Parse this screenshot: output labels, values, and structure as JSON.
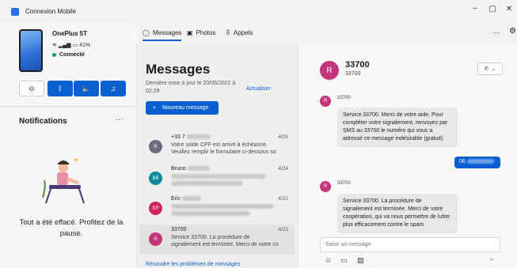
{
  "app": {
    "title": "Connexion Mobile",
    "window_controls": [
      "−",
      "▢",
      "✕"
    ]
  },
  "device": {
    "name": "OnePlus 5T",
    "battery": "41%",
    "status": "Connecté"
  },
  "quick_actions": [
    "⊖",
    "bluetooth",
    "volume",
    "music"
  ],
  "notifications": {
    "title": "Notifications",
    "more": "···",
    "empty_message": "Tout a été effacé. Profitez de la pause."
  },
  "tabs": [
    {
      "label": "Messages",
      "active": true
    },
    {
      "label": "Photos"
    },
    {
      "label": "Appels"
    }
  ],
  "top_more": "···",
  "messages": {
    "title": "Messages",
    "updated": "Dernière mise à jour le 20/05/2022 à 02:29",
    "refresh": "Actualiser",
    "new_button": "Nouveau message",
    "plus": "+",
    "troubleshoot": "Résoudre les problèmes de messages"
  },
  "conversations": [
    {
      "initials": "R",
      "name": "+33 7",
      "date": "4/26",
      "preview": "Votre solde CPF est arrivé à échéance. Veuillez remplir le formulaire ci-dessous so",
      "color": "#6b6b7b"
    },
    {
      "initials": "BB",
      "name": "Bruno",
      "date": "4/24",
      "preview": "",
      "color": "#0b8a9e"
    },
    {
      "initials": "EP",
      "name": "Eric",
      "date": "4/22",
      "preview": "",
      "color": "#d1245a"
    },
    {
      "initials": "R",
      "name": "33700",
      "date": "4/21",
      "preview": "Service 33700. La procédure de signalement est terminée. Merci de votre co",
      "color": "#c2357b"
    }
  ],
  "detail": {
    "avatar": "R",
    "name": "33700",
    "number": "33700",
    "call_icon": "✆",
    "incoming_1": {
      "sender": "33700",
      "text": "Service 33700. Merci de votre aide. Pour compléter votre signalement, renvoyez par SMS au 33700 le numéro qui vous a adressé ce message indésirable (gratuit)"
    },
    "outgoing": {
      "text": "06"
    },
    "incoming_2": {
      "sender": "33700",
      "text": "Service 33700. La procédure de signalement est terminée. Merci de votre coopération, qui va nous permettre de lutter plus efficacement contre le spam"
    },
    "input_placeholder": "Saisir un message"
  }
}
